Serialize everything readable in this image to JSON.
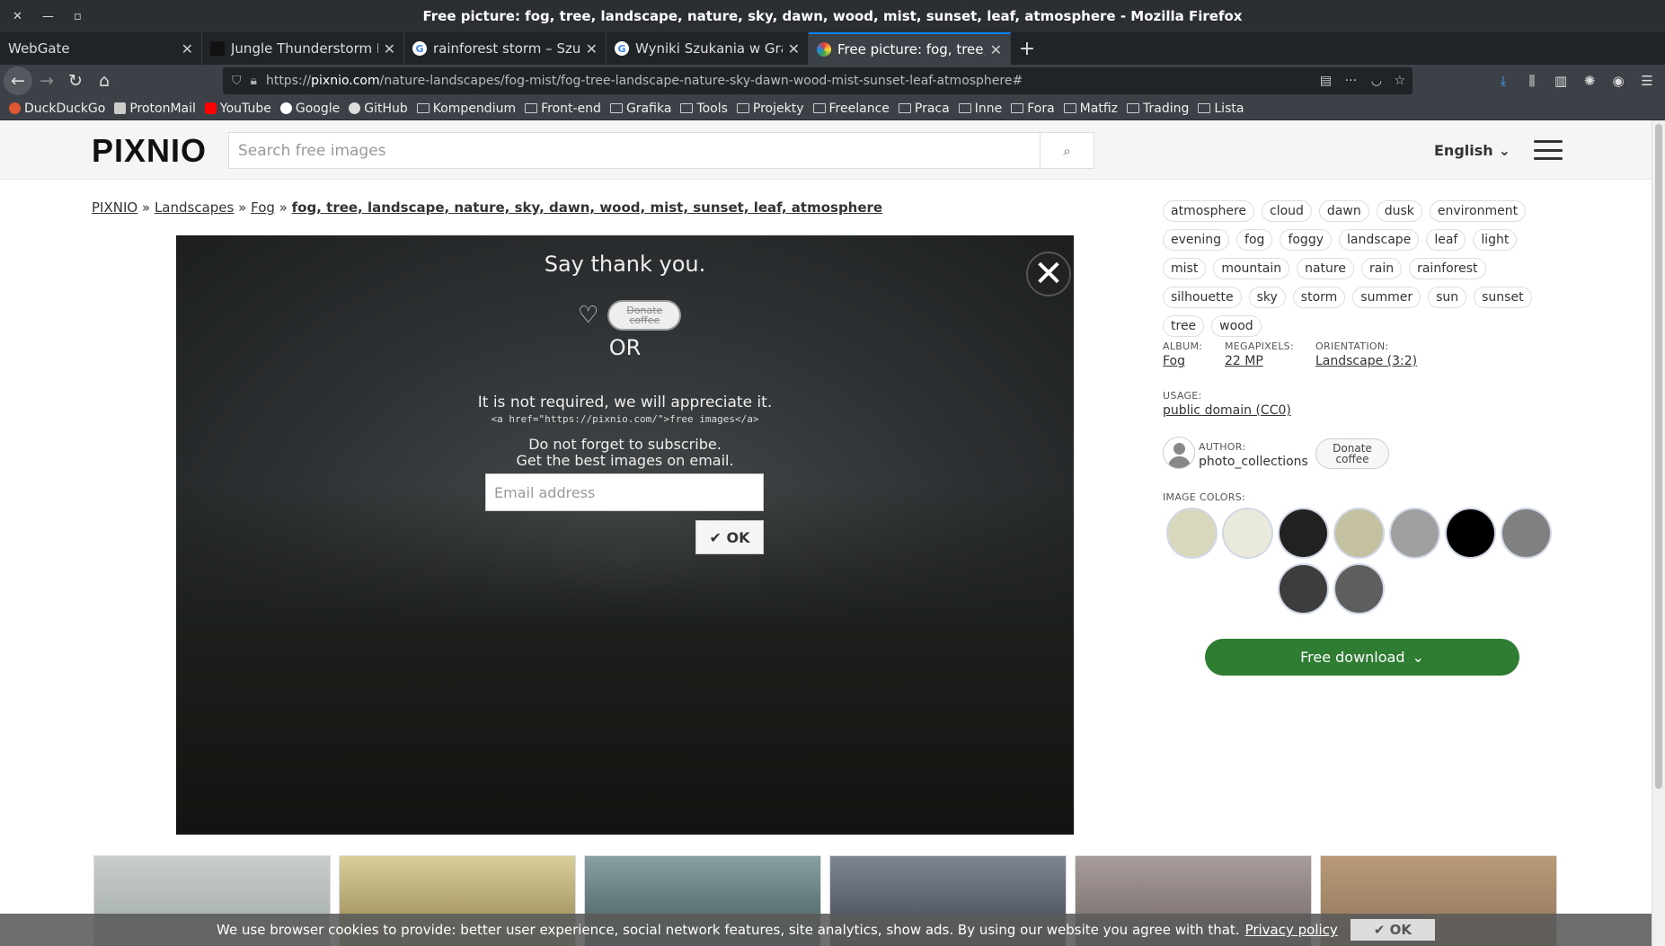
{
  "window": {
    "title": "Free picture: fog, tree, landscape, nature, sky, dawn, wood, mist, sunset, leaf, atmosphere - Mozilla Firefox"
  },
  "tabs": [
    {
      "label": "WebGate"
    },
    {
      "label": "Jungle Thunderstorm Pic"
    },
    {
      "label": "rainforest storm – Szuka"
    },
    {
      "label": "Wyniki Szukania w Grafic"
    },
    {
      "label": "Free picture: fog, tree, la"
    }
  ],
  "url": {
    "prefix": "https://",
    "host": "pixnio.com",
    "path": "/nature-landscapes/fog-mist/fog-tree-landscape-nature-sky-dawn-wood-mist-sunset-leaf-atmosphere#"
  },
  "bookmarks": [
    "DuckDuckGo",
    "ProtonMail",
    "YouTube",
    "Google",
    "GitHub",
    "Kompendium",
    "Front-end",
    "Grafika",
    "Tools",
    "Projekty",
    "Freelance",
    "Praca",
    "Inne",
    "Fora",
    "Matfiz",
    "Trading",
    "Lista"
  ],
  "site": {
    "logo": "PIXNIO",
    "search_placeholder": "Search free images",
    "language": "English"
  },
  "breadcrumb": {
    "root": "PIXNIO",
    "sep": "»",
    "cat": "Landscapes",
    "sub": "Fog",
    "current": "fog, tree, landscape, nature, sky, dawn, wood, mist, sunset, leaf, atmosphere"
  },
  "modal": {
    "close": "✕",
    "heading": "Say thank you.",
    "heart": "♡",
    "donate_line1": "Donate",
    "donate_line2": "coffee",
    "or": "OR",
    "not_required": "It is not required, we will appreciate it.",
    "code": "<a href=\"https://pixnio.com/\">free images</a>",
    "subscribe1": "Do not forget to subscribe.",
    "subscribe2": "Get the best images on email.",
    "email_placeholder": "Email address",
    "ok": "✔ OK"
  },
  "tags": [
    "atmosphere",
    "cloud",
    "dawn",
    "dusk",
    "environment",
    "evening",
    "fog",
    "foggy",
    "landscape",
    "leaf",
    "light",
    "mist",
    "mountain",
    "nature",
    "rain",
    "rainforest",
    "silhouette",
    "sky",
    "storm",
    "summer",
    "sun",
    "sunset",
    "tree",
    "wood"
  ],
  "meta": {
    "album_label": "ALBUM:",
    "album": "Fog",
    "mp_label": "MEGAPIXELS:",
    "mp": "22 MP",
    "orient_label": "ORIENTATION:",
    "orient": "Landscape (3:2)",
    "usage_label": "USAGE:",
    "usage": "public domain (CC0)",
    "author_label": "AUTHOR:",
    "author": "photo_collections",
    "donate1": "Donate",
    "donate2": "coffee",
    "colors_label": "IMAGE COLORS:"
  },
  "image_colors": [
    "#d9d8bd",
    "#e9eadb",
    "#222222",
    "#c4c1a1",
    "#a0a0a0",
    "#000000",
    "#808080",
    "#3d3d3d",
    "#5e5e5e"
  ],
  "download": "Free download",
  "cookie": {
    "text": "We use browser cookies to provide: better user experience, social network features, site analytics, show ads. By using our website you agree with that.",
    "link": "Privacy policy",
    "ok": "✔ OK"
  }
}
